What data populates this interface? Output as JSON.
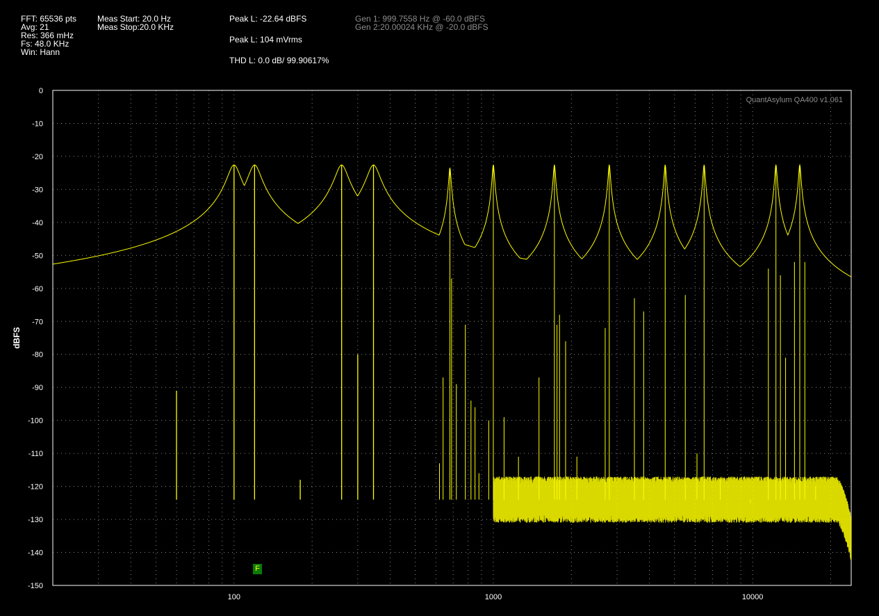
{
  "header": {
    "fft": "FFT: 65536 pts",
    "avg": "Avg: 21",
    "res": "Res: 366 mHz",
    "fs": "Fs: 48.0 KHz",
    "win": "Win: Hann",
    "meas_start": "Meas Start: 20.0 Hz",
    "meas_stop": "Meas Stop:20.0 KHz",
    "peak_dbfs": "Peak L: -22.64 dBFS",
    "peak_mvrms": "Peak L: 104 mVrms",
    "thd": "THD L: 0.0 dB/ 99.90617%",
    "gen1": "Gen 1: 999.7558 Hz @ -60.0  dBFS",
    "gen2": "Gen 2:20.00024 KHz @ -20.0  dBFS"
  },
  "marker": {
    "label": "F",
    "color": "#0a7a0a"
  },
  "colors": {
    "trace": "#ffff00",
    "grid": "#8a8a8a",
    "frame": "#ffffff",
    "background": "#000000"
  },
  "chart_data": {
    "type": "line",
    "title": "",
    "watermark": "QuantAsylum QA400 v1.061",
    "xlabel": "",
    "ylabel": "dBFS",
    "xscale": "log",
    "xlim": [
      20,
      24000
    ],
    "ylim": [
      -150,
      0
    ],
    "xticks": [
      100,
      1000,
      10000
    ],
    "xtick_labels": [
      "100",
      "1000",
      "10000"
    ],
    "yticks": [
      0,
      -10,
      -20,
      -30,
      -40,
      -50,
      -60,
      -70,
      -80,
      -90,
      -100,
      -110,
      -120,
      -130,
      -140,
      -150
    ],
    "grid": true,
    "noise_floor_dbfs": -124,
    "noise_rolloff": {
      "start_hz": 21000,
      "end_hz": 24000,
      "end_dbfs": -136
    },
    "peaks": [
      {
        "x": 60,
        "y": -91
      },
      {
        "x": 100,
        "y": -22.6
      },
      {
        "x": 120,
        "y": -22.6
      },
      {
        "x": 180,
        "y": -118
      },
      {
        "x": 260,
        "y": -22.6
      },
      {
        "x": 300,
        "y": -80
      },
      {
        "x": 345,
        "y": -22.6
      },
      {
        "x": 620,
        "y": -113
      },
      {
        "x": 640,
        "y": -87
      },
      {
        "x": 680,
        "y": -23.5
      },
      {
        "x": 690,
        "y": -57
      },
      {
        "x": 720,
        "y": -89
      },
      {
        "x": 780,
        "y": -71
      },
      {
        "x": 820,
        "y": -94
      },
      {
        "x": 850,
        "y": -96
      },
      {
        "x": 880,
        "y": -116
      },
      {
        "x": 960,
        "y": -100
      },
      {
        "x": 1000,
        "y": -22.6
      },
      {
        "x": 1100,
        "y": -99
      },
      {
        "x": 1250,
        "y": -111
      },
      {
        "x": 1500,
        "y": -87
      },
      {
        "x": 1720,
        "y": -22.6
      },
      {
        "x": 1760,
        "y": -71
      },
      {
        "x": 1800,
        "y": -68
      },
      {
        "x": 1900,
        "y": -76
      },
      {
        "x": 2100,
        "y": -111
      },
      {
        "x": 2700,
        "y": -72
      },
      {
        "x": 2800,
        "y": -22.6
      },
      {
        "x": 3500,
        "y": -63
      },
      {
        "x": 3800,
        "y": -67
      },
      {
        "x": 4600,
        "y": -22.6
      },
      {
        "x": 5500,
        "y": -62
      },
      {
        "x": 6100,
        "y": -110
      },
      {
        "x": 6500,
        "y": -22.6
      },
      {
        "x": 7500,
        "y": -118
      },
      {
        "x": 9800,
        "y": -125
      },
      {
        "x": 11500,
        "y": -54
      },
      {
        "x": 12300,
        "y": -22.6
      },
      {
        "x": 12800,
        "y": -56
      },
      {
        "x": 13400,
        "y": -81
      },
      {
        "x": 14500,
        "y": -52
      },
      {
        "x": 15200,
        "y": -22.6
      },
      {
        "x": 15900,
        "y": -52
      },
      {
        "x": 17500,
        "y": -120
      }
    ]
  }
}
